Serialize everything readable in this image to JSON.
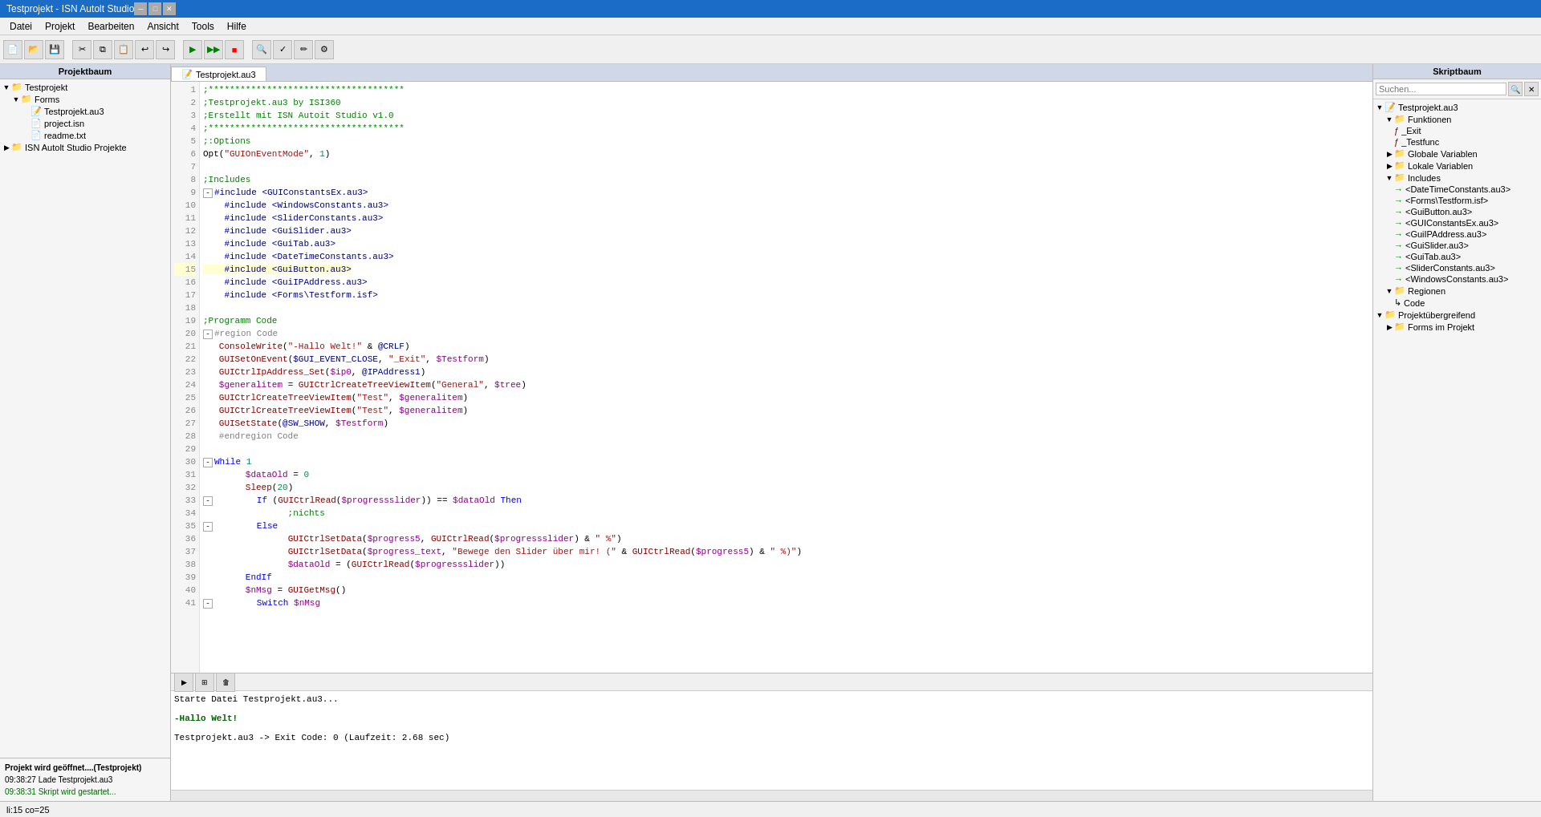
{
  "window": {
    "title": "Testprojekt - ISN Autolt Studio",
    "tab_label": "Testprojekt.au3"
  },
  "menu": {
    "items": [
      "Datei",
      "Projekt",
      "Bearbeiten",
      "Ansicht",
      "Tools",
      "Hilfe"
    ]
  },
  "project_panel": {
    "header": "Projektbaum",
    "tree": [
      {
        "id": "testprojekt",
        "label": "Testprojekt",
        "level": 0,
        "expanded": true,
        "type": "folder"
      },
      {
        "id": "forms",
        "label": "Forms",
        "level": 1,
        "expanded": true,
        "type": "folder"
      },
      {
        "id": "testprojekt_au3",
        "label": "Testprojekt.au3",
        "level": 2,
        "type": "file"
      },
      {
        "id": "project_isn",
        "label": "project.isn",
        "level": 2,
        "type": "file"
      },
      {
        "id": "readme_txt",
        "label": "readme.txt",
        "level": 2,
        "type": "file"
      },
      {
        "id": "isn_projekte",
        "label": "ISN Autolt Studio Projekte",
        "level": 0,
        "type": "folder"
      }
    ],
    "log": {
      "line1": "Projekt wird geöffnet....(Testprojekt)",
      "line2": "09:38:27  Lade Testprojekt.au3",
      "line3": "09:38:31  Skript wird gestartet..."
    }
  },
  "editor": {
    "tab": "Testprojekt.au3",
    "lines": [
      {
        "num": 1,
        "code": ";*************************************",
        "class": "c-comment"
      },
      {
        "num": 2,
        "code": ";Testprojekt.au3 by ISI360",
        "class": "c-comment"
      },
      {
        "num": 3,
        "code": ";Erstellt mit ISN Autoit Studio v1.0",
        "class": "c-comment"
      },
      {
        "num": 4,
        "code": ";*************************************",
        "class": "c-comment"
      },
      {
        "num": 5,
        "code": ";:Options",
        "class": "c-comment"
      },
      {
        "num": 6,
        "code": "Opt(\"GUIOnEventMode\", 1)",
        "class": "c-normal"
      },
      {
        "num": 7,
        "code": "",
        "class": "c-normal"
      },
      {
        "num": 8,
        "code": ";Includes",
        "class": "c-comment"
      },
      {
        "num": 9,
        "code": "#include <GUIConstantsEx.au3>",
        "class": "c-include"
      },
      {
        "num": 10,
        "code": "#include <WindowsConstants.au3>",
        "class": "c-include"
      },
      {
        "num": 11,
        "code": "#include <SliderConstants.au3>",
        "class": "c-include"
      },
      {
        "num": 12,
        "code": "#include <GuiSlider.au3>",
        "class": "c-include"
      },
      {
        "num": 13,
        "code": "#include <GuiTab.au3>",
        "class": "c-include"
      },
      {
        "num": 14,
        "code": "#include <DateTimeConstants.au3>",
        "class": "c-include"
      },
      {
        "num": 15,
        "code": "#include <GuiButton.au3>",
        "class": "c-include",
        "highlight": true
      },
      {
        "num": 16,
        "code": "#include <GuiIPAddress.au3>",
        "class": "c-include"
      },
      {
        "num": 17,
        "code": "#include <Forms\\Testform.isf>",
        "class": "c-include"
      },
      {
        "num": 18,
        "code": "",
        "class": "c-normal"
      },
      {
        "num": 19,
        "code": ";Programm Code",
        "class": "c-comment"
      },
      {
        "num": 20,
        "code": "#region Code",
        "class": "c-region",
        "foldable": true
      },
      {
        "num": 21,
        "code": "   ConsoleWrite(\"-Hallo Welt!\" & @CRLF)",
        "class": "c-normal"
      },
      {
        "num": 22,
        "code": "   GUISetOnEvent($GUI_EVENT_CLOSE, \"_Exit\", $Testform)",
        "class": "c-normal"
      },
      {
        "num": 23,
        "code": "   GUICtrlIpAddress_Set($ip0, @IPAddress1)",
        "class": "c-normal"
      },
      {
        "num": 24,
        "code": "   $generalitem = GUICtrlCreateTreeViewItem(\"General\", $tree)",
        "class": "c-normal"
      },
      {
        "num": 25,
        "code": "   GUICtrlCreateTreeViewItem(\"Test\", $generalitem)",
        "class": "c-normal"
      },
      {
        "num": 26,
        "code": "   GUICtrlCreateTreeViewItem(\"Test\", $generalitem)",
        "class": "c-normal"
      },
      {
        "num": 27,
        "code": "   GUISetState(@SW_SHOW, $Testform)",
        "class": "c-normal"
      },
      {
        "num": 28,
        "code": "   #endregion Code",
        "class": "c-region"
      },
      {
        "num": 29,
        "code": "",
        "class": "c-normal"
      },
      {
        "num": 30,
        "code": "While 1",
        "class": "c-keyword",
        "foldable": true
      },
      {
        "num": 31,
        "code": "        $dataOld = 0",
        "class": "c-normal"
      },
      {
        "num": 32,
        "code": "        Sleep(20)",
        "class": "c-normal"
      },
      {
        "num": 33,
        "code": "        If (GUICtrlRead($progressslider) == $dataOld Then",
        "class": "c-normal",
        "foldable": true
      },
      {
        "num": 34,
        "code": "                ;nichts",
        "class": "c-comment"
      },
      {
        "num": 35,
        "code": "        Else",
        "class": "c-keyword",
        "foldable": true
      },
      {
        "num": 36,
        "code": "                GUICtrlSetData($progress5, GUICtrlRead($progressslider) & \" %\")",
        "class": "c-normal"
      },
      {
        "num": 37,
        "code": "                GUICtrlSetData($progress_text, \"Bewege den Slider über mir! (\" & GUICtrlRead($progress5) & \" %)\")",
        "class": "c-normal"
      },
      {
        "num": 38,
        "code": "                $dataOld = (GUICtrlRead($progressslider))",
        "class": "c-normal"
      },
      {
        "num": 39,
        "code": "        EndIf",
        "class": "c-keyword"
      },
      {
        "num": 40,
        "code": "        $nMsg = GUIGetMsg()",
        "class": "c-normal"
      },
      {
        "num": 41,
        "code": "        Switch $nMsg",
        "class": "c-keyword",
        "foldable": true
      }
    ]
  },
  "output": {
    "line1": "Starte Datei Testprojekt.au3...",
    "line2": "",
    "line3": "-Hallo Welt!",
    "line4": "",
    "line5": "Testprojekt.au3 -> Exit Code: 0 (Laufzeit: 2.68 sec)"
  },
  "script_panel": {
    "header": "Skriptbaum",
    "search_placeholder": "Suchen...",
    "tree": [
      {
        "label": "Testprojekt.au3",
        "level": 0,
        "expanded": true,
        "type": "file"
      },
      {
        "label": "Funktionen",
        "level": 1,
        "expanded": true,
        "type": "folder"
      },
      {
        "label": "_Exit",
        "level": 2,
        "type": "func"
      },
      {
        "label": "_Testfunc",
        "level": 2,
        "type": "func"
      },
      {
        "label": "Globale Variablen",
        "level": 1,
        "type": "folder"
      },
      {
        "label": "Lokale Variablen",
        "level": 1,
        "type": "folder"
      },
      {
        "label": "Includes",
        "level": 1,
        "expanded": true,
        "type": "folder"
      },
      {
        "label": "<DateTimeConstants.au3>",
        "level": 2,
        "type": "include"
      },
      {
        "label": "<Forms\\Testform.isf>",
        "level": 2,
        "type": "include"
      },
      {
        "label": "<GuiButton.au3>",
        "level": 2,
        "type": "include"
      },
      {
        "label": "<GUIConstantsEx.au3>",
        "level": 2,
        "type": "include"
      },
      {
        "label": "<GuiIPAddress.au3>",
        "level": 2,
        "type": "include"
      },
      {
        "label": "<GuiSlider.au3>",
        "level": 2,
        "type": "include"
      },
      {
        "label": "<GuiTab.au3>",
        "level": 2,
        "type": "include"
      },
      {
        "label": "<SliderConstants.au3>",
        "level": 2,
        "type": "include"
      },
      {
        "label": "<WindowsConstants.au3>",
        "level": 2,
        "type": "include"
      },
      {
        "label": "Regionen",
        "level": 1,
        "expanded": true,
        "type": "folder"
      },
      {
        "label": "Code",
        "level": 2,
        "type": "region"
      },
      {
        "label": "Projektübergreifend",
        "level": 0,
        "expanded": true,
        "type": "folder"
      },
      {
        "label": "Forms im Projekt",
        "level": 1,
        "type": "folder"
      }
    ]
  },
  "status_bar": {
    "position": "li:15  co=25"
  }
}
